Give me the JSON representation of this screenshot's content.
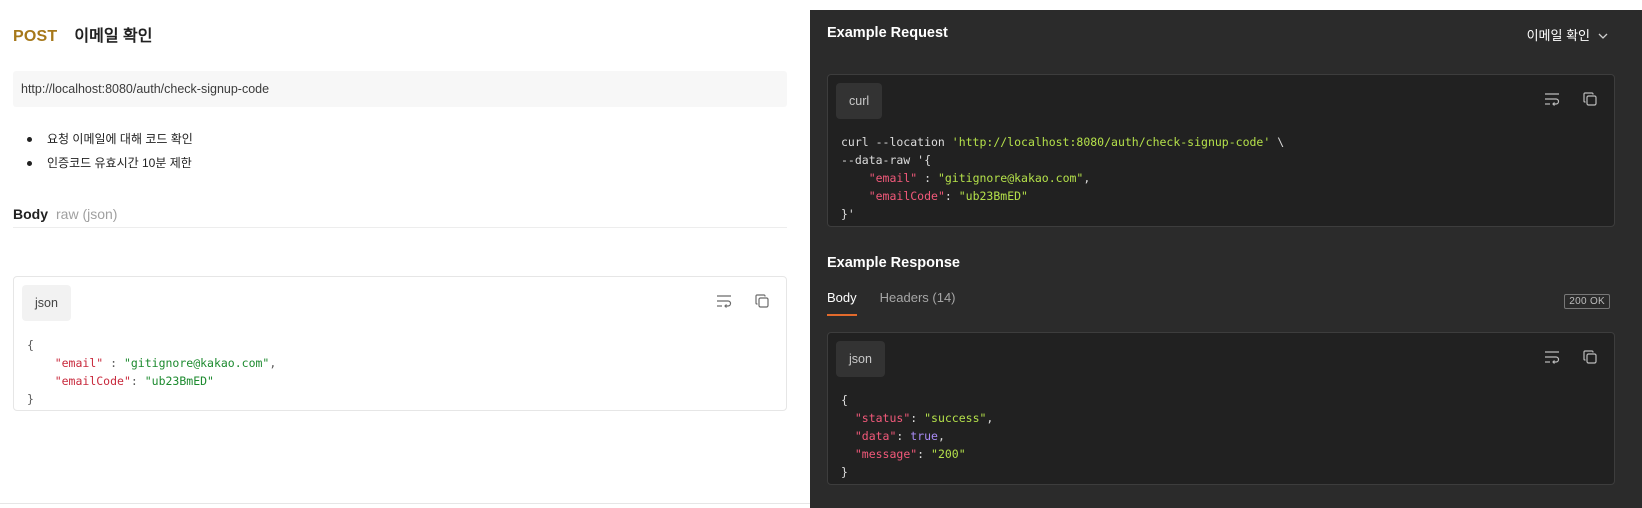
{
  "request": {
    "method": "POST",
    "name": "이메일 확인",
    "url": "http://localhost:8080/auth/check-signup-code",
    "bullets": [
      "요청 이메일에 대해 코드 확인",
      "인증코드 유효시간 10분 제한"
    ],
    "body_label": "Body",
    "body_type": "raw (json)",
    "body_lang": "json",
    "body_code": {
      "open": "{",
      "email_key": "\"email\"",
      "email_sep": " : ",
      "email_val": "\"gitignore@kakao.com\"",
      "email_comma": ",",
      "code_key": "\"emailCode\"",
      "code_sep": ": ",
      "code_val": "\"ub23BmED\"",
      "close": "}"
    }
  },
  "example": {
    "request_title": "Example Request",
    "request_selector": "이메일 확인",
    "request_lang": "curl",
    "curl": {
      "cmd": "curl --location ",
      "url": "'http://localhost:8080/auth/check-signup-code'",
      "cont": " \\",
      "data_raw": "--data-raw '{",
      "email_key": "\"email\"",
      "email_sep": " : ",
      "email_val": "\"gitignore@kakao.com\"",
      "email_comma": ",",
      "code_key": "\"emailCode\"",
      "code_sep": ": ",
      "code_val": "\"ub23BmED\"",
      "close": "}'"
    },
    "response_title": "Example Response",
    "response_tabs": [
      "Body",
      "Headers (14)"
    ],
    "status": "200 OK",
    "response_lang": "json",
    "response_code": {
      "open": "{",
      "status_key": "\"status\"",
      "status_val": "\"success\"",
      "data_key": "\"data\"",
      "data_val": "true",
      "message_key": "\"message\"",
      "message_val": "\"200\"",
      "close": "}"
    }
  },
  "colors": {
    "method": "#a6781a",
    "active_tab_underline": "#e26a2c",
    "dark_panel": "#2b2b2b"
  }
}
